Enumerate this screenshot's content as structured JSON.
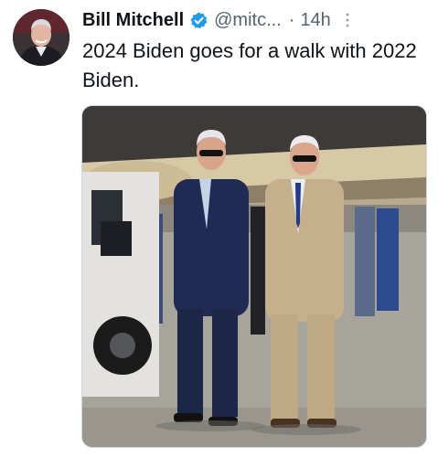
{
  "tweet": {
    "author": {
      "display_name": "Bill Mitchell",
      "handle": "@mitc...",
      "verified": true,
      "verified_color": "#1d9bf0",
      "avatar_icon": "user-avatar"
    },
    "separator": "·",
    "timestamp": "14h",
    "more_icon": "more-vertical-icon",
    "text": "2024 Biden goes for a walk with 2022 Biden."
  }
}
